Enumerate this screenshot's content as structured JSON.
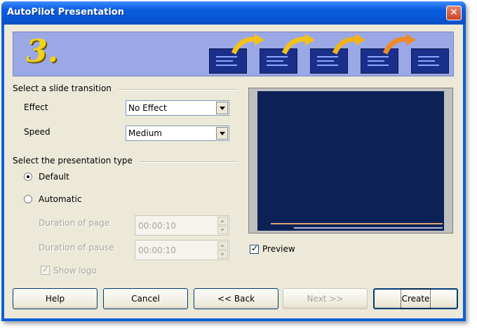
{
  "window": {
    "title": "AutoPilot Presentation"
  },
  "header": {
    "step_number": "3."
  },
  "transition": {
    "group_label": "Select a slide transition",
    "effect_label": "Effect",
    "effect_value": "No Effect",
    "speed_label": "Speed",
    "speed_value": "Medium"
  },
  "presentation_type": {
    "group_label": "Select the presentation type",
    "default_label": "Default",
    "automatic_label": "Automatic",
    "selected": "Default",
    "duration_page_label": "Duration of page",
    "duration_page_value": "00:00:10",
    "duration_pause_label": "Duration of pause",
    "duration_pause_value": "00:00:10",
    "show_logo_label": "Show logo",
    "show_logo_checked": true
  },
  "preview": {
    "label": "Preview",
    "checked": true
  },
  "buttons": {
    "help": "Help",
    "cancel": "Cancel",
    "back": "<< Back",
    "next": "Next >>",
    "create": "Create"
  },
  "colors": {
    "titlebar": "#0a5fd8",
    "dialog_bg": "#ece9d8",
    "banner": "#9aa8e6",
    "preview_slide": "#0c2257"
  }
}
